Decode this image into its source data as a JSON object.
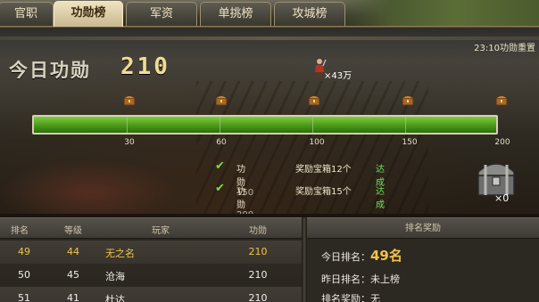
{
  "tabs": [
    {
      "label": "官职",
      "active": false
    },
    {
      "label": "功勋榜",
      "active": true
    },
    {
      "label": "军资",
      "active": false
    },
    {
      "label": "单挑榜",
      "active": false
    },
    {
      "label": "攻城榜",
      "active": false
    }
  ],
  "panel": {
    "reset_text": "23:10功勋重置",
    "title": "今日功勋",
    "score": "210",
    "troops": "×43万"
  },
  "progress": {
    "value": 210,
    "max": 200,
    "fraction": 1.0,
    "milestones": [
      "30",
      "60",
      "100",
      "150",
      "200"
    ]
  },
  "rewards": [
    {
      "label": "功勋",
      "threshold": "150",
      "box": "奖励宝箱12个",
      "status": "达成"
    },
    {
      "label": "功勋",
      "threshold": "200",
      "box": "奖励宝箱15个",
      "status": "达成"
    }
  ],
  "chest": {
    "count": "×0"
  },
  "table": {
    "headers": [
      "排名",
      "等级",
      "玩家",
      "功勋"
    ],
    "rows": [
      {
        "rank": "49",
        "level": "44",
        "player": "无之名",
        "merit": "210"
      },
      {
        "rank": "50",
        "level": "45",
        "player": "沧海",
        "merit": "210"
      },
      {
        "rank": "51",
        "level": "41",
        "player": "杜达",
        "merit": "210"
      }
    ]
  },
  "rank_panel": {
    "title": "排名奖励",
    "today_label": "今日排名：",
    "today_rank": "49名",
    "yesterday_label": "昨日排名：",
    "yesterday_value": "未上榜",
    "reward_label": "排名奖励：",
    "reward_value": "无"
  },
  "colors": {
    "accent_gold": "#f0c34a",
    "bar_green": "#4a9a1a",
    "done_green": "#6fe35a"
  }
}
